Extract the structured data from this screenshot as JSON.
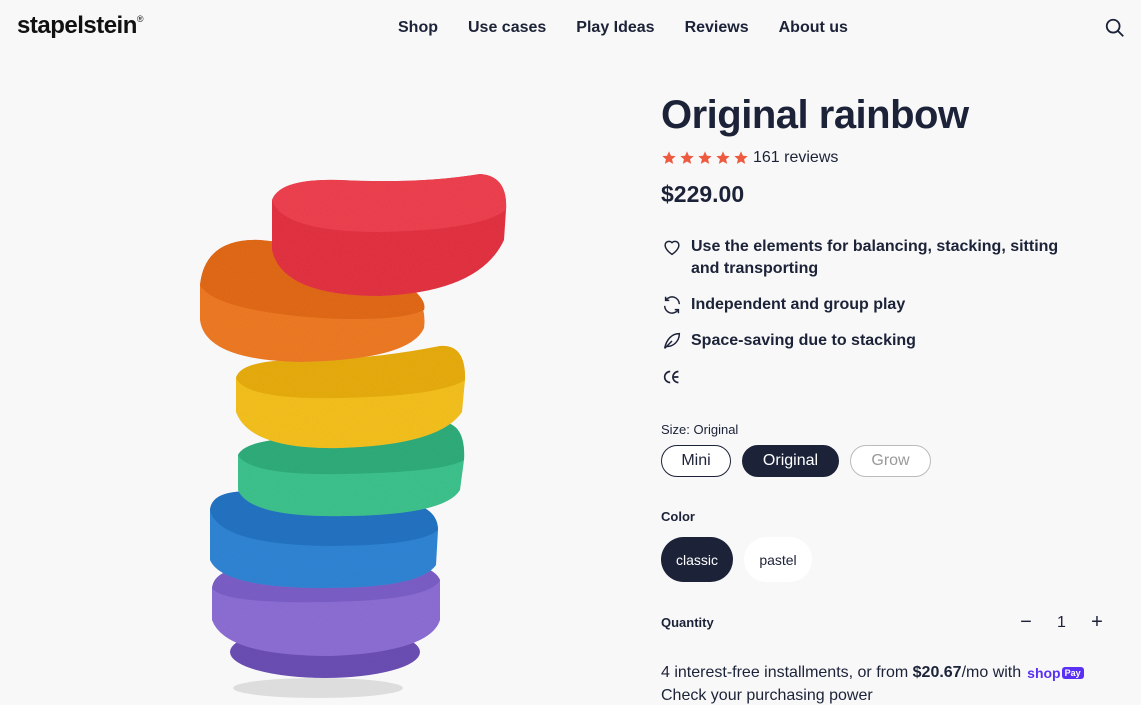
{
  "header": {
    "logo": "stapelstein",
    "logo_mark": "®",
    "nav": [
      "Shop",
      "Use cases",
      "Play Ideas",
      "Reviews",
      "About us"
    ],
    "search_icon": "search-icon"
  },
  "product": {
    "title": "Original rainbow",
    "rating_stars": 5,
    "reviews": "161 reviews",
    "price": "$229.00",
    "features": [
      {
        "icon": "heart-icon",
        "text": "Use the elements for balancing, stacking, sitting and transporting"
      },
      {
        "icon": "refresh-icon",
        "text": "Independent and group play"
      },
      {
        "icon": "leaf-icon",
        "text": "Space-saving due to stacking"
      },
      {
        "icon": "ce-mark-icon",
        "text": ""
      }
    ],
    "size": {
      "label": "Size: Original",
      "options": [
        "Mini",
        "Original",
        "Grow"
      ],
      "selected": "Original",
      "unavailable": [
        "Grow"
      ]
    },
    "color": {
      "label": "Color",
      "options": [
        "classic",
        "pastel"
      ],
      "selected": "classic"
    },
    "quantity": {
      "label": "Quantity",
      "minus": "−",
      "value": "1",
      "plus": "+"
    },
    "installments": {
      "prefix": "4 interest-free installments, or from ",
      "amount": "$20.67",
      "suffix": "/mo with",
      "brand": "shop",
      "brand_badge": "Pay",
      "check": "Check your purchasing power"
    }
  },
  "colors": {
    "navy": "#1c2238",
    "star": "#ee5a40",
    "shoppay": "#5a31f4"
  }
}
